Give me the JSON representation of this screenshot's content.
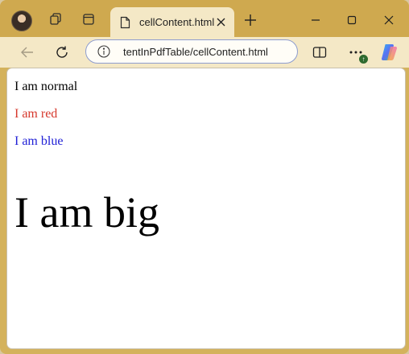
{
  "browser": {
    "tab_title": "cellContent.html",
    "address": "tentInPdfTable/cellContent.html",
    "icons": {
      "profile": "avatar",
      "workspaces": "workspaces-icon",
      "tab_actions": "tab-actions-icon",
      "page": "page-icon",
      "close_tab": "close-icon",
      "new_tab": "plus-icon",
      "minimize": "minimize-icon",
      "maximize": "maximize-icon",
      "close_window": "close-icon",
      "back": "back-arrow-icon",
      "refresh": "refresh-icon",
      "info": "info-icon",
      "split": "split-screen-icon",
      "more": "more-icon",
      "copilot": "copilot-icon"
    },
    "colors": {
      "frame": "#cfa94f",
      "toolbar": "#f4e8c6",
      "address_border": "#8d9ccf"
    }
  },
  "page": {
    "line_normal": "I am normal",
    "line_red": "I am red",
    "line_blue": "I am blue",
    "line_big": "I am big",
    "colors": {
      "red": "#d6382c",
      "blue": "#1f1fd6"
    }
  }
}
